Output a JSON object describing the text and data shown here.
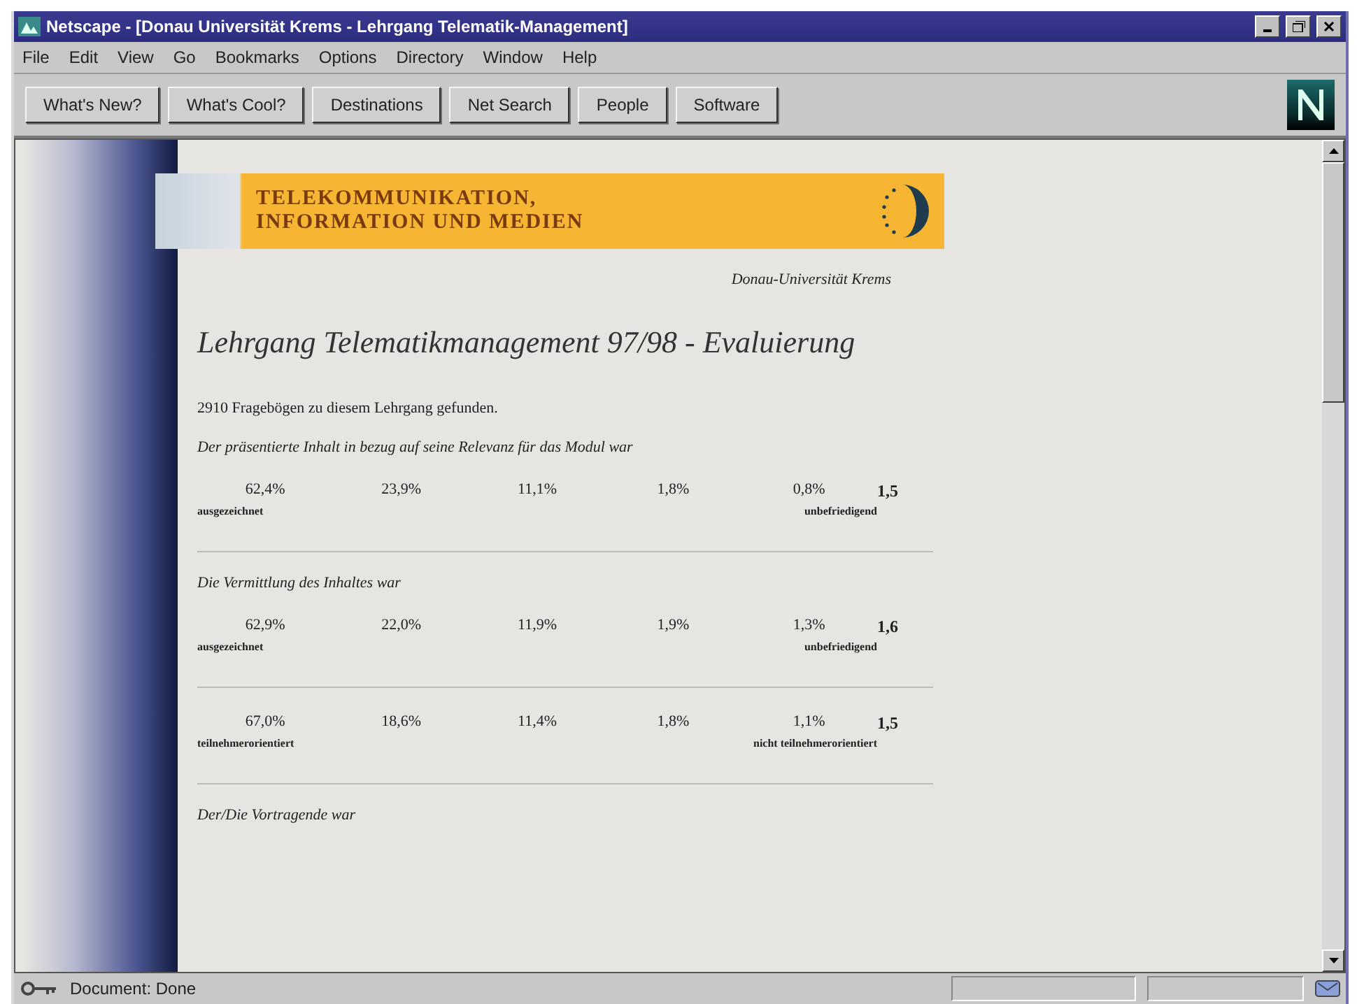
{
  "window": {
    "title": "Netscape - [Donau Universität Krems - Lehrgang Telematik-Management]"
  },
  "menu": [
    "File",
    "Edit",
    "View",
    "Go",
    "Bookmarks",
    "Options",
    "Directory",
    "Window",
    "Help"
  ],
  "toolbar": [
    "What's New?",
    "What's Cool?",
    "Destinations",
    "Net Search",
    "People",
    "Software"
  ],
  "banner": {
    "line_1": "TELEKOMMUNIKATION,",
    "line_2": "INFORMATION UND MEDIEN"
  },
  "institution": "Donau-Universität Krems",
  "heading": "Lehrgang Telematikmanagement 97/98 - Evaluierung",
  "summary": "2910 Fragebögen zu diesem Lehrgang gefunden.",
  "questions": [
    {
      "question": "Der präsentierte Inhalt in bezug auf seine Relevanz für das Modul war",
      "values": [
        "62,4%",
        "23,9%",
        "11,1%",
        "1,8%",
        "0,8%"
      ],
      "low_label": "ausgezeichnet",
      "high_label": "unbefriedigend",
      "score": "1,5"
    },
    {
      "question": "Die Vermittlung des Inhaltes war",
      "values": [
        "62,9%",
        "22,0%",
        "11,9%",
        "1,9%",
        "1,3%"
      ],
      "low_label": "ausgezeichnet",
      "high_label": "unbefriedigend",
      "score": "1,6"
    },
    {
      "values": [
        "67,0%",
        "18,6%",
        "11,4%",
        "1,8%",
        "1,1%"
      ],
      "low_label": "teilnehmerorientiert",
      "high_label": "nicht teilnehmerorientiert",
      "score": "1,5"
    },
    {
      "question": "Der/Die Vortragende war"
    }
  ],
  "status_bar": {
    "text": "Document: Done"
  }
}
